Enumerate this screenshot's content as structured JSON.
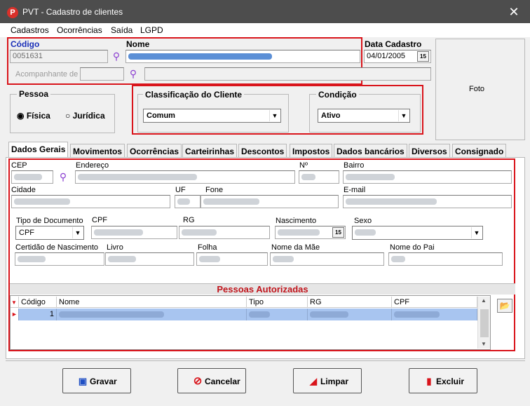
{
  "window": {
    "title": "PVT - Cadastro de clientes",
    "app_icon": "P",
    "close": "✕"
  },
  "menu": [
    "Cadastros",
    "Ocorrências",
    "Saída",
    "LGPD"
  ],
  "header": {
    "codigo_label": "Código",
    "codigo_value": "0051631",
    "nome_label": "Nome",
    "data_cadastro_label": "Data Cadastro",
    "data_cadastro_value": "04/01/2005",
    "acompanhante_label": "Acompanhante de",
    "foto_label": "Foto"
  },
  "pessoa": {
    "label": "Pessoa",
    "fisica": "Física",
    "juridica": "Jurídica",
    "selected": "Física"
  },
  "classificacao": {
    "label": "Classificação do Cliente",
    "value": "Comum"
  },
  "condicao": {
    "label": "Condição",
    "value": "Ativo"
  },
  "tabs": [
    "Dados Gerais",
    "Movimentos",
    "Ocorrências",
    "Carteirinhas",
    "Descontos",
    "Impostos",
    "Dados bancários",
    "Diversos",
    "Consignado"
  ],
  "form": {
    "cep": "CEP",
    "endereco": "Endereço",
    "numero": "Nº",
    "bairro": "Bairro",
    "cidade": "Cidade",
    "uf": "UF",
    "fone": "Fone",
    "email": "E-mail",
    "tipo_documento": "Tipo de Documento",
    "tipo_documento_value": "CPF",
    "cpf": "CPF",
    "rg": "RG",
    "nascimento": "Nascimento",
    "sexo": "Sexo",
    "certidao": "Certidão de Nascimento",
    "livro": "Livro",
    "folha": "Folha",
    "nome_mae": "Nome da Mãe",
    "nome_pai": "Nome do Pai"
  },
  "autorizadas": {
    "title": "Pessoas Autorizadas",
    "columns": [
      "Código",
      "Nome",
      "Tipo",
      "RG",
      "CPF"
    ],
    "rows": [
      {
        "codigo": "1"
      }
    ]
  },
  "buttons": {
    "gravar": "Gravar",
    "cancelar": "Cancelar",
    "limpar": "Limpar",
    "excluir": "Excluir"
  },
  "colors": {
    "highlight_red": "#d9141b",
    "title_red": "#c0141b",
    "selection_blue": "#a8c5f0"
  }
}
